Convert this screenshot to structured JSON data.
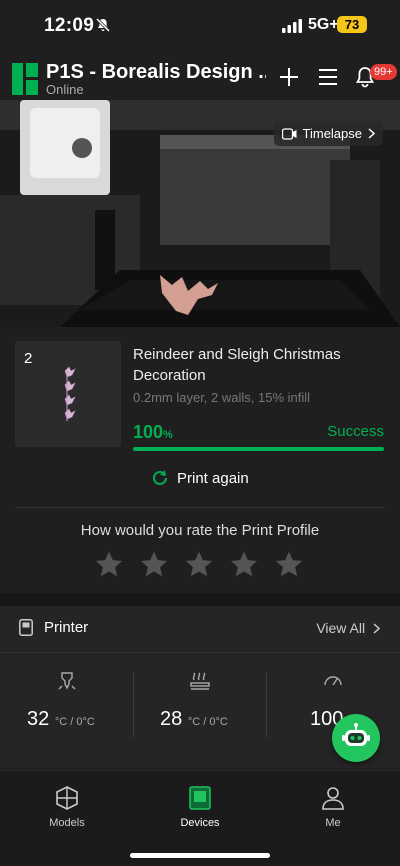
{
  "status_bar": {
    "time": "12:09",
    "network": "5G+",
    "battery": "73"
  },
  "header": {
    "title": "P1S - Borealis Design ...",
    "subtitle": "Online",
    "badge": "99+"
  },
  "camera": {
    "timelapse_label": "Timelapse"
  },
  "job": {
    "plate_number": "2",
    "name": "Reindeer and Sleigh Christmas Decoration",
    "settings": "0.2mm layer, 2 walls, 15% infill",
    "progress_value": "100",
    "progress_unit": "%",
    "progress_fraction": 1.0,
    "status": "Success",
    "print_again_label": "Print again"
  },
  "rating": {
    "question": "How would you rate the Print Profile",
    "stars_filled": 0,
    "stars_total": 5
  },
  "printer": {
    "title": "Printer",
    "view_all": "View All",
    "stats": [
      {
        "value": "32",
        "unit": "°C / 0°C"
      },
      {
        "value": "28",
        "unit": "°C / 0°C"
      },
      {
        "value": "100",
        "unit": ""
      }
    ]
  },
  "tabs": [
    {
      "label": "Models"
    },
    {
      "label": "Devices"
    },
    {
      "label": "Me"
    }
  ],
  "colors": {
    "accent": "#00b050",
    "badge": "#e53935",
    "battery": "#f5c518",
    "background": "#1f1f1f"
  }
}
